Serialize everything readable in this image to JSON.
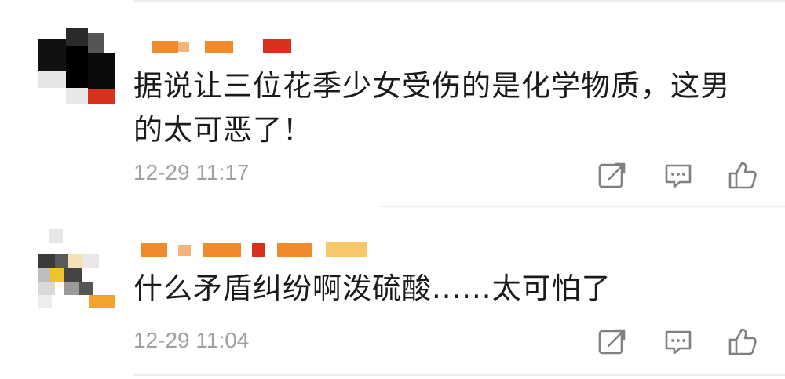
{
  "comments": [
    {
      "text": "据说让三位花季少女受伤的是化学物质，这男的太可恶了！",
      "time": "12-29 11:17",
      "icons": [
        "share-icon",
        "comment-icon",
        "like-icon"
      ]
    },
    {
      "text": "什么矛盾纠纷啊泼硫酸......太可怕了",
      "time": "12-29 11:04",
      "icons": [
        "share-icon",
        "comment-icon",
        "like-icon"
      ]
    }
  ],
  "colors": {
    "text": "#1a1a1a",
    "timestamp": "#a0a0a0",
    "icon": "#808080",
    "divider": "#eeeeee",
    "username_pixels": [
      "#f08a2c",
      "#f6b47a",
      "#d8321e",
      "#f7c86a"
    ]
  }
}
